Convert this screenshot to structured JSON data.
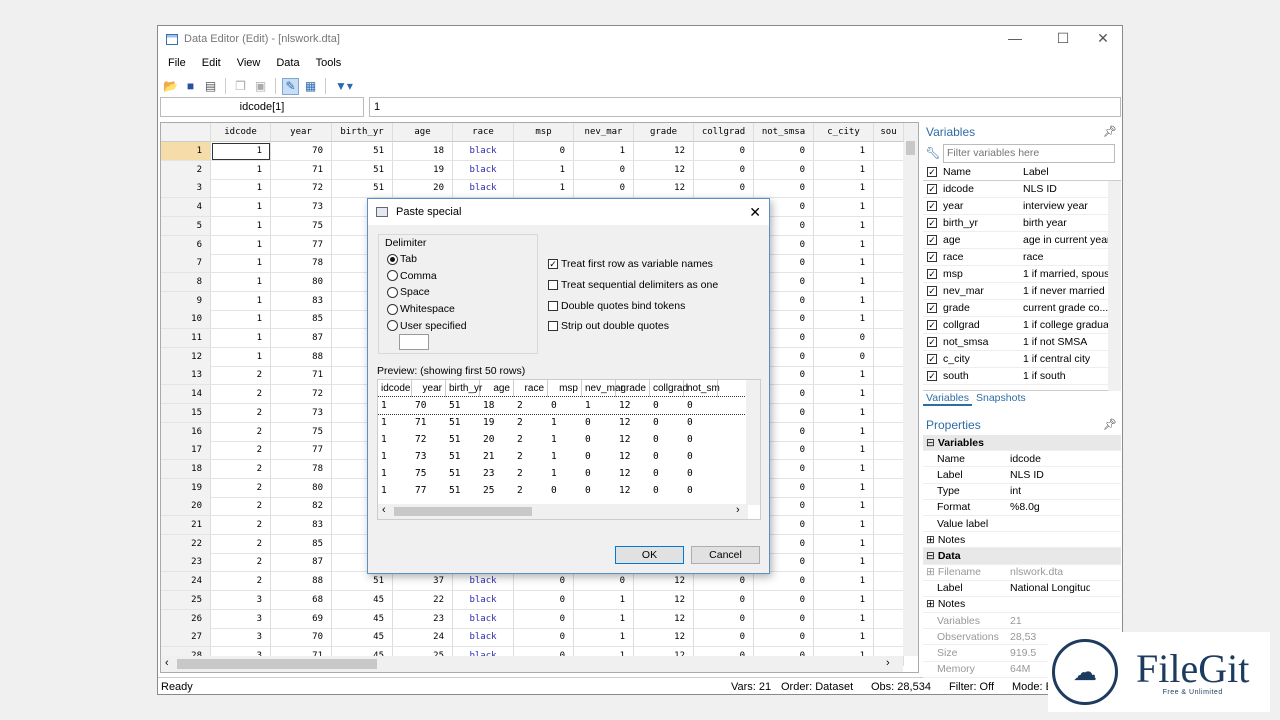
{
  "window": {
    "title": "Data Editor (Edit) - [nlswork.dta]",
    "icon": "table-icon",
    "controls": [
      "minimize",
      "maximize",
      "close"
    ]
  },
  "menu": [
    "File",
    "Edit",
    "View",
    "Data",
    "Tools"
  ],
  "toolbar": {
    "icons": [
      "open-icon",
      "save-icon",
      "print-icon",
      "copy-icon",
      "paste-icon",
      "edit-mode-icon",
      "browse-mode-icon",
      "filter-icon"
    ]
  },
  "cell_ref": "idcode[1]",
  "cell_value": "1",
  "grid": {
    "columns": [
      "idcode",
      "year",
      "birth_yr",
      "age",
      "race",
      "msp",
      "nev_mar",
      "grade",
      "collgrad",
      "not_smsa",
      "c_city",
      "sou"
    ],
    "string_color": "#2a2ab0",
    "rows": [
      [
        1,
        70,
        51,
        18,
        "black",
        0,
        1,
        12,
        0,
        0,
        1
      ],
      [
        1,
        71,
        51,
        19,
        "black",
        1,
        0,
        12,
        0,
        0,
        1
      ],
      [
        1,
        72,
        51,
        20,
        "black",
        1,
        0,
        12,
        0,
        0,
        1
      ],
      [
        1,
        73,
        null,
        null,
        null,
        null,
        null,
        null,
        null,
        0,
        1
      ],
      [
        1,
        75,
        null,
        null,
        null,
        null,
        null,
        null,
        null,
        0,
        1
      ],
      [
        1,
        77,
        null,
        null,
        null,
        null,
        null,
        null,
        null,
        0,
        1
      ],
      [
        1,
        78,
        null,
        null,
        null,
        null,
        null,
        null,
        null,
        0,
        1
      ],
      [
        1,
        80,
        null,
        null,
        null,
        null,
        null,
        null,
        null,
        0,
        1
      ],
      [
        1,
        83,
        null,
        null,
        null,
        null,
        null,
        null,
        null,
        0,
        1
      ],
      [
        1,
        85,
        null,
        null,
        null,
        null,
        null,
        null,
        null,
        0,
        1
      ],
      [
        1,
        87,
        null,
        null,
        null,
        null,
        null,
        null,
        null,
        0,
        0
      ],
      [
        1,
        88,
        null,
        null,
        null,
        null,
        null,
        null,
        null,
        0,
        0
      ],
      [
        2,
        71,
        null,
        null,
        null,
        null,
        null,
        null,
        null,
        0,
        1
      ],
      [
        2,
        72,
        null,
        null,
        null,
        null,
        null,
        null,
        null,
        0,
        1
      ],
      [
        2,
        73,
        null,
        null,
        null,
        null,
        null,
        null,
        null,
        0,
        1
      ],
      [
        2,
        75,
        null,
        null,
        null,
        null,
        null,
        null,
        null,
        0,
        1
      ],
      [
        2,
        77,
        null,
        null,
        null,
        null,
        null,
        null,
        null,
        0,
        1
      ],
      [
        2,
        78,
        null,
        null,
        null,
        null,
        null,
        null,
        null,
        0,
        1
      ],
      [
        2,
        80,
        null,
        null,
        null,
        null,
        null,
        null,
        null,
        0,
        1
      ],
      [
        2,
        82,
        null,
        null,
        null,
        null,
        null,
        null,
        null,
        0,
        1
      ],
      [
        2,
        83,
        null,
        null,
        null,
        null,
        null,
        null,
        null,
        0,
        1
      ],
      [
        2,
        85,
        null,
        null,
        null,
        null,
        null,
        null,
        null,
        0,
        1
      ],
      [
        2,
        87,
        null,
        null,
        null,
        null,
        null,
        null,
        null,
        0,
        1
      ],
      [
        2,
        88,
        51,
        37,
        "black",
        0,
        0,
        12,
        0,
        0,
        1
      ],
      [
        3,
        68,
        45,
        22,
        "black",
        0,
        1,
        12,
        0,
        0,
        1
      ],
      [
        3,
        69,
        45,
        23,
        "black",
        0,
        1,
        12,
        0,
        0,
        1
      ],
      [
        3,
        70,
        45,
        24,
        "black",
        0,
        1,
        12,
        0,
        0,
        1
      ],
      [
        3,
        71,
        45,
        25,
        "black",
        0,
        1,
        12,
        0,
        0,
        1
      ]
    ]
  },
  "status": {
    "left": "Ready",
    "vars": "Vars: 21",
    "order": "Order: Dataset",
    "obs": "Obs: 28,534",
    "filter": "Filter: Off",
    "mode": "Mode: Edit"
  },
  "variables_panel": {
    "title": "Variables",
    "filter_placeholder": "Filter variables here",
    "col_name": "Name",
    "col_label": "Label",
    "items": [
      [
        "idcode",
        "NLS ID"
      ],
      [
        "year",
        "interview year"
      ],
      [
        "birth_yr",
        "birth year"
      ],
      [
        "age",
        "age in current year"
      ],
      [
        "race",
        "race"
      ],
      [
        "msp",
        "1 if married, spous..."
      ],
      [
        "nev_mar",
        "1 if never married"
      ],
      [
        "grade",
        "current grade co..."
      ],
      [
        "collgrad",
        "1 if college gradua..."
      ],
      [
        "not_smsa",
        "1 if not SMSA"
      ],
      [
        "c_city",
        "1 if central city"
      ],
      [
        "south",
        "1 if south"
      ]
    ],
    "tabs": [
      "Variables",
      "Snapshots"
    ]
  },
  "properties_panel": {
    "title": "Properties",
    "rows": [
      {
        "k": "Variables",
        "group": true,
        "exp": "⊟"
      },
      {
        "k": "Name",
        "v": "idcode"
      },
      {
        "k": "Label",
        "v": "NLS ID"
      },
      {
        "k": "Type",
        "v": "int"
      },
      {
        "k": "Format",
        "v": "%8.0g"
      },
      {
        "k": "Value label",
        "v": ""
      },
      {
        "k": "Notes",
        "v": "",
        "exp": "⊞"
      },
      {
        "k": "Data",
        "group": true,
        "exp": "⊟"
      },
      {
        "k": "Filename",
        "v": "nlswork.dta",
        "dim": true,
        "exp": "⊞"
      },
      {
        "k": "Label",
        "v": "National Longitud"
      },
      {
        "k": "Notes",
        "v": "",
        "exp": "⊞"
      },
      {
        "k": "Variables",
        "v": "21",
        "dim": true
      },
      {
        "k": "Observations",
        "v": "28,53",
        "dim": true
      },
      {
        "k": "Size",
        "v": "919.5",
        "dim": true
      },
      {
        "k": "Memory",
        "v": "64M",
        "dim": true
      }
    ]
  },
  "dialog": {
    "title": "Paste special",
    "group_label": "Delimiter",
    "radios": [
      {
        "label": "Tab",
        "on": true
      },
      {
        "label": "Comma"
      },
      {
        "label": "Space"
      },
      {
        "label": "Whitespace"
      },
      {
        "label": "User specified"
      }
    ],
    "checks": [
      {
        "label": "Treat first row as variable names",
        "on": true
      },
      {
        "label": "Treat sequential delimiters as one"
      },
      {
        "label": "Double quotes bind tokens"
      },
      {
        "label": "Strip out double quotes"
      }
    ],
    "preview_label": "Preview: (showing first 50 rows)",
    "preview_cols": [
      "idcode",
      "year",
      "birth_yr",
      "age",
      "race",
      "msp",
      "nev_mar",
      "grade",
      "collgrad",
      "not_sm"
    ],
    "preview_rows": [
      [
        1,
        70,
        51,
        18,
        2,
        0,
        1,
        12,
        0,
        0
      ],
      [
        1,
        71,
        51,
        19,
        2,
        1,
        0,
        12,
        0,
        0
      ],
      [
        1,
        72,
        51,
        20,
        2,
        1,
        0,
        12,
        0,
        0
      ],
      [
        1,
        73,
        51,
        21,
        2,
        1,
        0,
        12,
        0,
        0
      ],
      [
        1,
        75,
        51,
        23,
        2,
        1,
        0,
        12,
        0,
        0
      ],
      [
        1,
        77,
        51,
        25,
        2,
        0,
        0,
        12,
        0,
        0
      ]
    ],
    "ok": "OK",
    "cancel": "Cancel"
  },
  "watermark": {
    "brand": "FileGit",
    "tagline": "Free & Unlimited",
    "color": "#1d3a5f"
  }
}
